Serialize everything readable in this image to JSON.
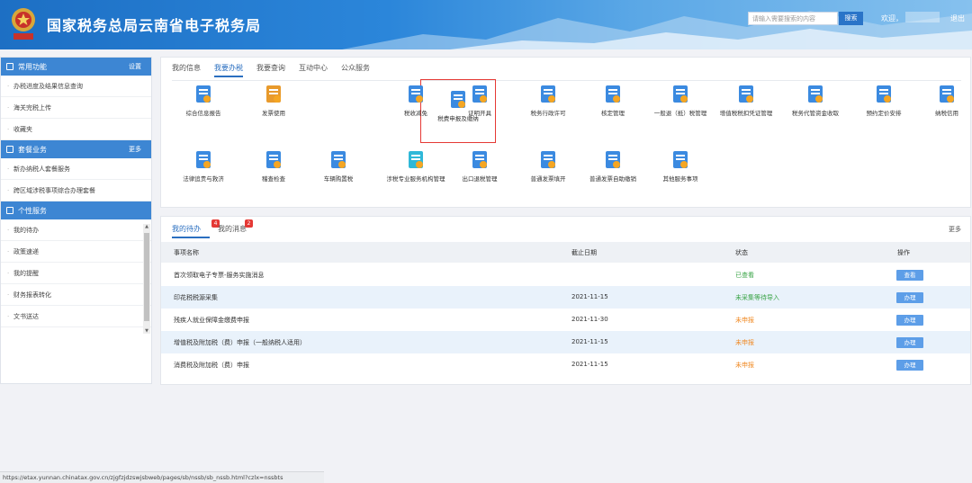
{
  "header": {
    "title": "国家税务总局云南省电子税务局",
    "search_placeholder": "请输入需要搜索的内容",
    "search_button": "搜索",
    "welcome": "欢迎，",
    "logout": "退出"
  },
  "sidebar": {
    "sections": [
      {
        "title": "常用功能",
        "more": "设置",
        "items": [
          "办税进度及结果信息查询",
          "海关完税上传",
          "收藏夹"
        ]
      },
      {
        "title": "套餐业务",
        "more": "更多",
        "items": [
          "新办纳税人套餐服务",
          "跨区域涉税事项综合办理套餐"
        ]
      },
      {
        "title": "个性服务",
        "more": "",
        "items": [
          "我的待办",
          "政策速递",
          "我的提醒",
          "财务报表转化",
          "文书送达"
        ]
      }
    ]
  },
  "tabs": [
    "我的信息",
    "我要办税",
    "我要查询",
    "互动中心",
    "公众服务"
  ],
  "tiles": [
    {
      "label": "综合信息报告",
      "color": "#3b8ae0"
    },
    {
      "label": "发票使用",
      "color": "#e89a2c"
    },
    {
      "label": "税费申报及缴纳",
      "color": "#3b8ae0"
    },
    {
      "label": "税收减免",
      "color": "#3b8ae0"
    },
    {
      "label": "证明开具",
      "color": "#3b8ae0"
    },
    {
      "label": "税务行政许可",
      "color": "#3b8ae0"
    },
    {
      "label": "核定管理",
      "color": "#3b8ae0"
    },
    {
      "label": "一般退（抵）税管理",
      "color": "#3b8ae0"
    },
    {
      "label": "增值税税扣凭证管理",
      "color": "#3b8ae0"
    },
    {
      "label": "税务代管资金收取",
      "color": "#3b8ae0"
    },
    {
      "label": "预约定价安排",
      "color": "#3b8ae0"
    },
    {
      "label": "纳税信用",
      "color": "#3b8ae0"
    },
    {
      "label": "法律追责与救济",
      "color": "#3b8ae0"
    },
    {
      "label": "稽查检查",
      "color": "#3b8ae0"
    },
    {
      "label": "车辆购置税",
      "color": "#3b8ae0"
    },
    {
      "label": "涉税专业服务机构管理",
      "color": "#2fb8d8"
    },
    {
      "label": "出口退税管理",
      "color": "#3b8ae0"
    },
    {
      "label": "普通发票填开",
      "color": "#3b8ae0"
    },
    {
      "label": "普通发票自助缴销",
      "color": "#3b8ae0"
    },
    {
      "label": "其他服务事项",
      "color": "#3b8ae0"
    }
  ],
  "tile_icons": {
    "text_sb": "申",
    "text_xin": "信",
    "text_tui": "退税",
    "text_yen": "¥"
  },
  "todo": {
    "tab_todo": "我的待办",
    "tab_todo_badge": "4",
    "tab_msg": "我的消息",
    "tab_msg_badge": "2",
    "more": "更多",
    "columns": [
      "事项名称",
      "截止日期",
      "状态",
      "操作"
    ],
    "rows": [
      {
        "name": "首次领取电子专票-服务实施消息",
        "date": "",
        "status": "已查看",
        "status_color": "green",
        "action": "查看"
      },
      {
        "name": "印花税税源采集",
        "date": "2021-11-15",
        "status": "未采集等待导入",
        "status_color": "green",
        "action": "办理"
      },
      {
        "name": "残疾人就业保障金缴费申报",
        "date": "2021-11-30",
        "status": "未申报",
        "status_color": "orange",
        "action": "办理"
      },
      {
        "name": "增值税及附加税（费）申报（一般纳税人适用）",
        "date": "2021-11-15",
        "status": "未申报",
        "status_color": "orange",
        "action": "办理"
      },
      {
        "name": "消费税及附加税（费）申报",
        "date": "2021-11-15",
        "status": "未申报",
        "status_color": "orange",
        "action": "办理"
      }
    ]
  },
  "statusbar": "https://etax.yunnan.chinatax.gov.cn/zjgfzjdzswjsbweb/pages/sb/nssb/sb_nssb.html?czlx=nssbts"
}
